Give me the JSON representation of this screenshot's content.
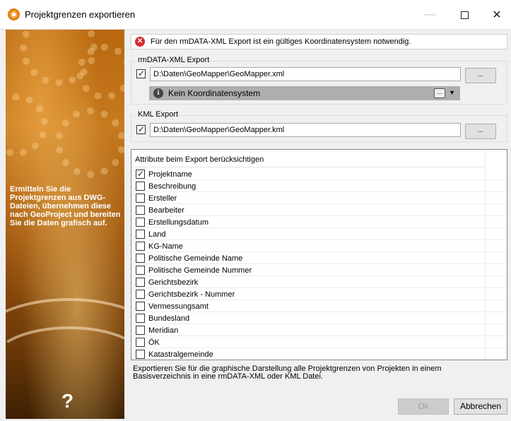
{
  "window": {
    "title": "Projektgrenzen exportieren",
    "minimize": "—",
    "close": "✕"
  },
  "sidebar": {
    "text": "Ermitteln Sie die Projektgrenzen aus DWG-Dateien, übernehmen diese nach GeoProject und bereiten Sie die Daten grafisch auf.",
    "help": "?"
  },
  "error": {
    "icon": "✕",
    "message": "Für den rmDATA-XML Export ist ein gültiges Koordinatensystem notwendig."
  },
  "xml_export": {
    "title": "rmDATA-XML Export",
    "checked": true,
    "path": "D:\\Daten\\GeoMapper\\GeoMapper.xml",
    "browse": "...",
    "coord_system": "Kein Koordinatensystem",
    "coord_btn": "...",
    "dropdown": "▼"
  },
  "kml_export": {
    "title": "KML Export",
    "checked": true,
    "path": "D:\\Daten\\GeoMapper\\GeoMapper.kml",
    "browse": "..."
  },
  "attributes": {
    "header": "Attribute beim Export berücksichtigen",
    "items": [
      {
        "label": "Projektname",
        "checked": true
      },
      {
        "label": "Beschreibung",
        "checked": false
      },
      {
        "label": "Ersteller",
        "checked": false
      },
      {
        "label": "Bearbeiter",
        "checked": false
      },
      {
        "label": "Erstellungsdatum",
        "checked": false
      },
      {
        "label": "Land",
        "checked": false
      },
      {
        "label": "KG-Name",
        "checked": false
      },
      {
        "label": "Politische Gemeinde Name",
        "checked": false
      },
      {
        "label": "Politische Gemeinde Nummer",
        "checked": false
      },
      {
        "label": "Gerichtsbezirk",
        "checked": false
      },
      {
        "label": "Gerichtsbezirk - Nummer",
        "checked": false
      },
      {
        "label": "Vermessungsamt",
        "checked": false
      },
      {
        "label": "Bundesland",
        "checked": false
      },
      {
        "label": "Meridian",
        "checked": false
      },
      {
        "label": "ÖK",
        "checked": false
      },
      {
        "label": "Katastralgemeinde",
        "checked": false
      }
    ]
  },
  "footer": {
    "description": "Exportieren Sie für die graphische Darstellung alle Projektgrenzen von Projekten in einem Basisverzeichnis in eine rmDATA-XML oder KML Datei.",
    "ok": "Ok",
    "cancel": "Abbrechen"
  }
}
